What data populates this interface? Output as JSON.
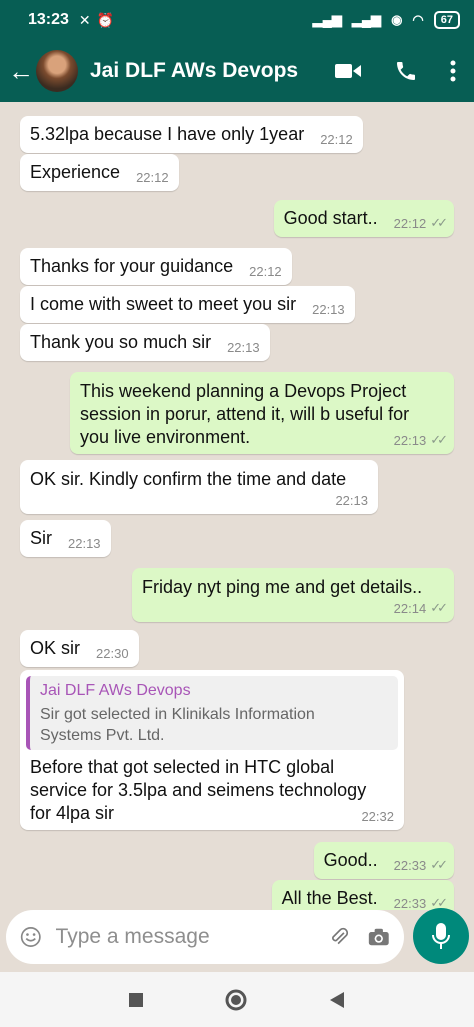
{
  "status": {
    "time": "13:23",
    "battery": "67"
  },
  "header": {
    "title": "Jai DLF AWs Devops"
  },
  "messages": [
    {
      "text": "5.32lpa because I have only 1year",
      "time": "22:12"
    },
    {
      "text": "Experience",
      "time": "22:12"
    },
    {
      "text": "Good start..",
      "time": "22:12"
    },
    {
      "text": "Thanks for your guidance",
      "time": "22:12"
    },
    {
      "text": "I come with sweet to meet you sir",
      "time": "22:13"
    },
    {
      "text": "Thank you so much sir",
      "time": "22:13"
    },
    {
      "lines": [
        "This weekend planning a Devops Project",
        "session in porur, attend it, will b useful for",
        "you live environment."
      ],
      "time": "22:13"
    },
    {
      "text": "OK sir. Kindly confirm the time and date",
      "time": "22:13"
    },
    {
      "text": "Sir",
      "time": "22:13"
    },
    {
      "text": "Friday nyt ping me and get details..",
      "time": "22:14"
    },
    {
      "text": "OK sir",
      "time": "22:30"
    },
    {
      "quote_name": "Jai DLF AWs Devops",
      "quote_lines": [
        "Sir got selected in Klinikals Information",
        "Systems Pvt. Ltd."
      ],
      "lines": [
        "Before that got selected in HTC global",
        "service for 3.5lpa and seimens technology",
        "for 4lpa sir"
      ],
      "time": "22:32"
    },
    {
      "text": "Good..",
      "time": "22:33"
    },
    {
      "text": "All the Best.",
      "time": "22:33"
    }
  ],
  "input": {
    "placeholder": "Type a message"
  },
  "colors": {
    "header": "#075e54",
    "outgoing": "#dcf8c6",
    "incoming": "#ffffff",
    "mic": "#00897b",
    "quote_accent": "#a855b7"
  }
}
